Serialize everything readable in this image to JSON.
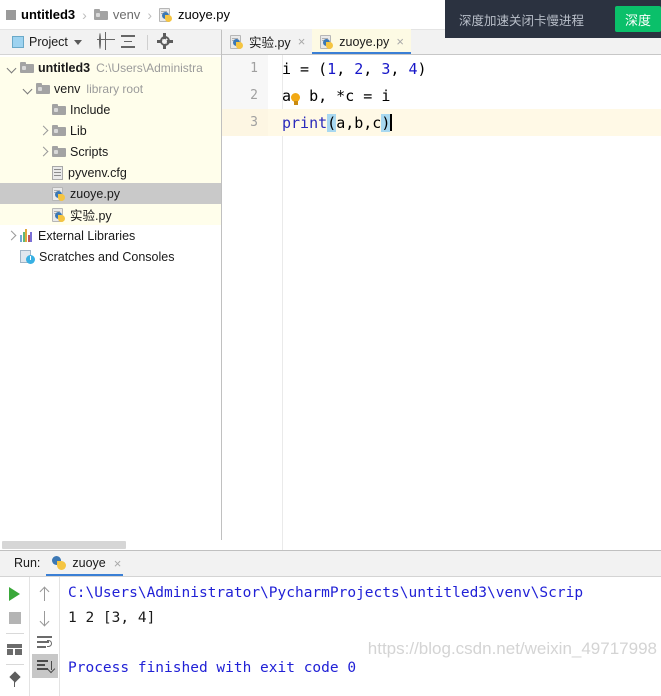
{
  "breadcrumb": {
    "items": [
      {
        "label": "untitled3",
        "icon": "project-square-icon",
        "bold": true
      },
      {
        "label": "venv",
        "icon": "folder-icon",
        "bold": false
      },
      {
        "label": "zuoye.py",
        "icon": "python-file-icon",
        "bold": false
      }
    ],
    "separator": "›"
  },
  "project_panel": {
    "title": "Project",
    "caret": "▾",
    "icons": [
      "project-icon",
      "locate-target-icon",
      "collapse-all-icon",
      "settings-gear-icon",
      "hide-icon"
    ],
    "tree": [
      {
        "label": "untitled3",
        "note": "C:\\Users\\Administra",
        "icon": "folder-icon",
        "twisty": "down",
        "indent": 0,
        "bold": true,
        "selected": false,
        "bg": "yellow"
      },
      {
        "label": "venv",
        "note": "library root",
        "icon": "folder-icon",
        "twisty": "down",
        "indent": 1,
        "bold": false,
        "selected": false,
        "bg": "yellow"
      },
      {
        "label": "Include",
        "note": "",
        "icon": "folder-icon",
        "twisty": "none",
        "indent": 2,
        "bold": false,
        "selected": false,
        "bg": "yellow"
      },
      {
        "label": "Lib",
        "note": "",
        "icon": "folder-icon",
        "twisty": "right",
        "indent": 2,
        "bold": false,
        "selected": false,
        "bg": "yellow"
      },
      {
        "label": "Scripts",
        "note": "",
        "icon": "folder-icon",
        "twisty": "right",
        "indent": 2,
        "bold": false,
        "selected": false,
        "bg": "yellow"
      },
      {
        "label": "pyvenv.cfg",
        "note": "",
        "icon": "config-file-icon",
        "twisty": "none",
        "indent": 2,
        "bold": false,
        "selected": false,
        "bg": "yellow"
      },
      {
        "label": "zuoye.py",
        "note": "",
        "icon": "python-file-icon",
        "twisty": "none",
        "indent": 2,
        "bold": false,
        "selected": true,
        "bg": "selected"
      },
      {
        "label": "实验.py",
        "note": "",
        "icon": "python-file-icon",
        "twisty": "none",
        "indent": 2,
        "bold": false,
        "selected": false,
        "bg": "yellow"
      },
      {
        "label": "External Libraries",
        "note": "",
        "icon": "libraries-icon",
        "twisty": "right",
        "indent": 0,
        "bold": false,
        "selected": false,
        "bg": "white"
      },
      {
        "label": "Scratches and Consoles",
        "note": "",
        "icon": "scratches-icon",
        "twisty": "none",
        "indent": 0,
        "bold": false,
        "selected": false,
        "bg": "white"
      }
    ]
  },
  "editor": {
    "tabs": [
      {
        "label": "实验.py",
        "active": false,
        "close": "×",
        "icon": "python-file-icon"
      },
      {
        "label": "zuoye.py",
        "active": true,
        "close": "×",
        "icon": "python-file-icon"
      }
    ],
    "lines": [
      {
        "number": "1",
        "text": "i = (1, 2, 3, 4)",
        "current": false
      },
      {
        "number": "2",
        "text": "a, b, *c = i",
        "current": false
      },
      {
        "number": "3",
        "text": "print(a,b,c)",
        "current": true
      }
    ],
    "intention_icon": "lightbulb-icon"
  },
  "notification": {
    "message": "深度加速关闭卡慢进程",
    "button_label": "深度",
    "button_color": "#0ac06a"
  },
  "run_panel": {
    "label": "Run:",
    "tab_label": "zuoye",
    "tab_close": "×",
    "toolbar_left": [
      "run-icon",
      "stop-icon",
      "layout-icon",
      "pin-icon"
    ],
    "toolbar_right": [
      "up-arrow-icon",
      "down-arrow-icon",
      "soft-wrap-icon",
      "scroll-to-end-icon"
    ],
    "console_lines": [
      {
        "text": "C:\\Users\\Administrator\\PycharmProjects\\untitled3\\venv\\Scrip",
        "type": "path"
      },
      {
        "text": "1 2 [3, 4]",
        "type": "out"
      },
      {
        "text": "",
        "type": "out"
      },
      {
        "text": "Process finished with exit code 0",
        "type": "fin"
      }
    ],
    "watermark": "https://blog.csdn.net/weixin_49717998"
  }
}
